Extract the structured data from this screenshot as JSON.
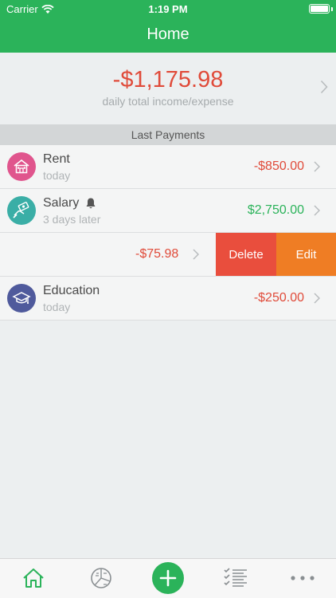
{
  "status_bar": {
    "carrier": "Carrier",
    "time": "1:19 PM"
  },
  "nav": {
    "title": "Home"
  },
  "summary": {
    "total": "-$1,175.98",
    "caption": "daily total income/expense"
  },
  "section": {
    "title": "Last Payments"
  },
  "payments": [
    {
      "title": "Rent",
      "subtitle": "today",
      "amount": "-$850.00",
      "icon": "house-icon",
      "color": "#e0558d"
    },
    {
      "title": "Salary",
      "subtitle": "3 days later",
      "amount": "$2,750.00",
      "icon": "money-hand-icon",
      "color": "#3aaea6",
      "reminder_icon": "bell-icon"
    },
    {
      "amount": "-$75.98"
    },
    {
      "title": "Education",
      "subtitle": "today",
      "amount": "-$250.00",
      "icon": "graduation-cap-icon",
      "color": "#4f5a9c"
    }
  ],
  "swipe_actions": {
    "delete": "Delete",
    "edit": "Edit"
  },
  "tabbar": {
    "items": [
      "home-icon",
      "chart-icon",
      "add-icon",
      "checklist-icon",
      "more-icon"
    ],
    "active_color": "#2bb35a"
  }
}
